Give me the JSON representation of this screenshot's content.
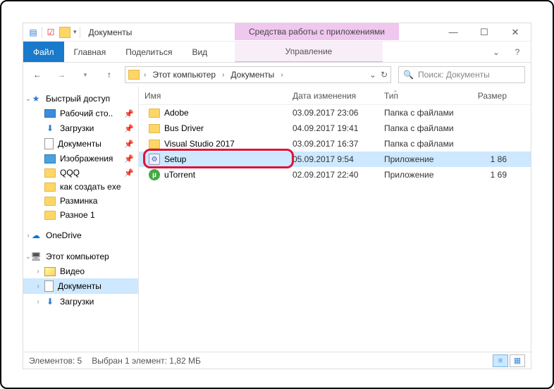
{
  "window_title": "Документы",
  "context_tab": "Средства работы с приложениями",
  "context_sub": "Управление",
  "ribbon": {
    "file": "Файл",
    "tabs": [
      "Главная",
      "Поделиться",
      "Вид"
    ]
  },
  "breadcrumbs": [
    "Этот компьютер",
    "Документы"
  ],
  "search_placeholder": "Поиск: Документы",
  "columns": {
    "name": "Имя",
    "date": "Дата изменения",
    "type": "Тип",
    "size": "Размер"
  },
  "sidebar": {
    "quick_access": "Быстрый доступ",
    "items_qa": [
      {
        "label": "Рабочий сто..",
        "icon": "desktop",
        "pinned": true
      },
      {
        "label": "Загрузки",
        "icon": "downloads",
        "pinned": true
      },
      {
        "label": "Документы",
        "icon": "docs",
        "pinned": true
      },
      {
        "label": "Изображения",
        "icon": "images",
        "pinned": true
      },
      {
        "label": "QQQ",
        "icon": "folder",
        "pinned": true
      },
      {
        "label": "как создать exe",
        "icon": "folder",
        "pinned": false
      },
      {
        "label": "Разминка",
        "icon": "folder",
        "pinned": false
      },
      {
        "label": "Разное 1",
        "icon": "folder",
        "pinned": false
      }
    ],
    "onedrive": "OneDrive",
    "this_pc": "Этот компьютер",
    "items_pc": [
      {
        "label": "Видео",
        "icon": "video"
      },
      {
        "label": "Документы",
        "icon": "docs",
        "active": true
      },
      {
        "label": "Загрузки",
        "icon": "downloads"
      }
    ]
  },
  "files": [
    {
      "name": "Adobe",
      "date": "03.09.2017 23:06",
      "type": "Папка с файлами",
      "size": "",
      "icon": "folder"
    },
    {
      "name": "Bus Driver",
      "date": "04.09.2017 19:41",
      "type": "Папка с файлами",
      "size": "",
      "icon": "folder"
    },
    {
      "name": "Visual Studio 2017",
      "date": "03.09.2017 16:37",
      "type": "Папка с файлами",
      "size": "",
      "icon": "folder"
    },
    {
      "name": "Setup",
      "date": "05.09.2017 9:54",
      "type": "Приложение",
      "size": "1 86",
      "icon": "app",
      "selected": true,
      "highlighted": true
    },
    {
      "name": "uTorrent",
      "date": "02.09.2017 22:40",
      "type": "Приложение",
      "size": "1 69",
      "icon": "utorrent"
    }
  ],
  "status": {
    "count": "Элементов: 5",
    "selection": "Выбран 1 элемент: 1,82 МБ"
  }
}
